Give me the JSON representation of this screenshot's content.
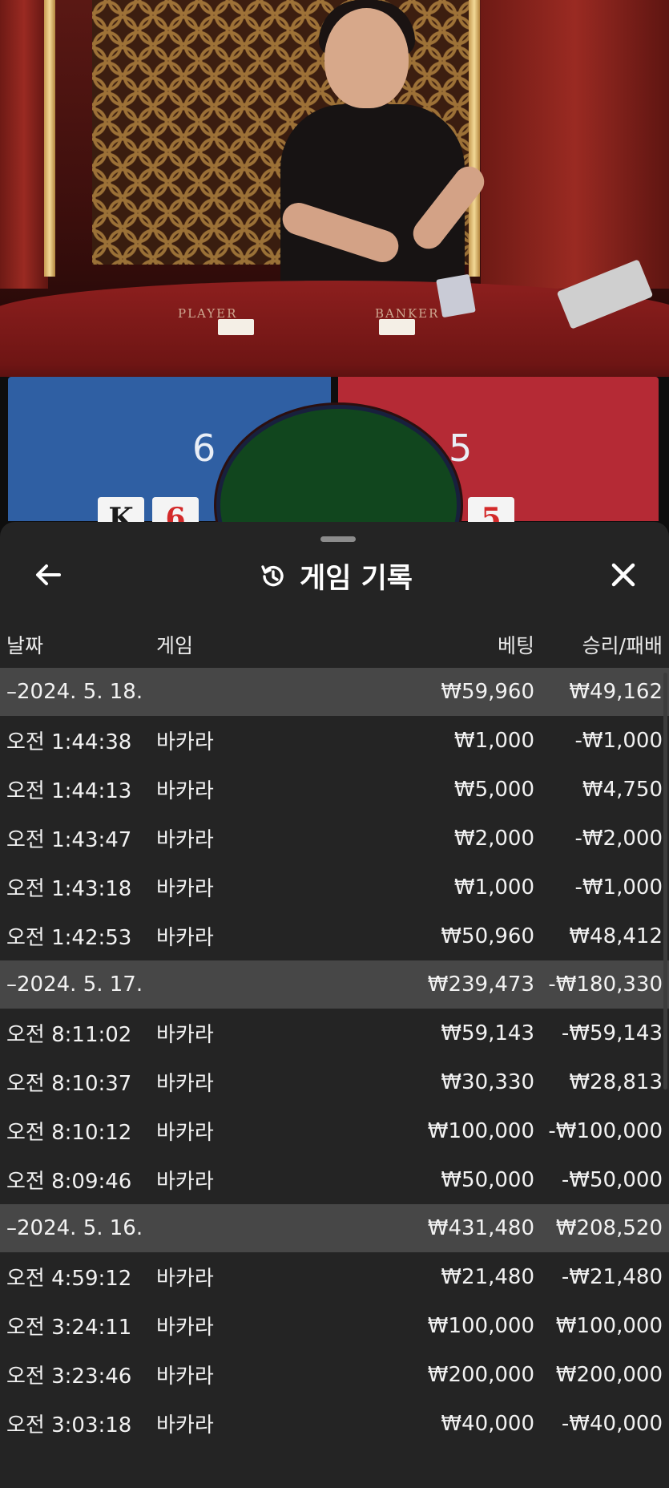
{
  "scene": {
    "felt_left": "PLAYER",
    "felt_right": "BANKER",
    "player_score": "6",
    "banker_score": "5",
    "player_cards": [
      {
        "rank": "K",
        "color": "black"
      },
      {
        "rank": "6",
        "color": "red"
      }
    ],
    "banker_cards": [
      {
        "rank": "5",
        "color": "red"
      }
    ]
  },
  "sheet": {
    "title": "게임 기록",
    "back_icon": "arrow-left",
    "close_icon": "close-x",
    "history_icon": "clock-counterclockwise",
    "columns": {
      "date": "날짜",
      "game": "게임",
      "bet": "베팅",
      "result": "승리/패배"
    },
    "groups": [
      {
        "date": "–2024. 5. 18.",
        "bet_total": "₩59,960",
        "result_total": "₩49,162",
        "rows": [
          {
            "time": "오전 1:44:38",
            "game": "바카라",
            "bet": "₩1,000",
            "result": "-₩1,000"
          },
          {
            "time": "오전 1:44:13",
            "game": "바카라",
            "bet": "₩5,000",
            "result": "₩4,750"
          },
          {
            "time": "오전 1:43:47",
            "game": "바카라",
            "bet": "₩2,000",
            "result": "-₩2,000"
          },
          {
            "time": "오전 1:43:18",
            "game": "바카라",
            "bet": "₩1,000",
            "result": "-₩1,000"
          },
          {
            "time": "오전 1:42:53",
            "game": "바카라",
            "bet": "₩50,960",
            "result": "₩48,412"
          }
        ]
      },
      {
        "date": "–2024. 5. 17.",
        "bet_total": "₩239,473",
        "result_total": "-₩180,330",
        "rows": [
          {
            "time": "오전 8:11:02",
            "game": "바카라",
            "bet": "₩59,143",
            "result": "-₩59,143"
          },
          {
            "time": "오전 8:10:37",
            "game": "바카라",
            "bet": "₩30,330",
            "result": "₩28,813"
          },
          {
            "time": "오전 8:10:12",
            "game": "바카라",
            "bet": "₩100,000",
            "result": "-₩100,000"
          },
          {
            "time": "오전 8:09:46",
            "game": "바카라",
            "bet": "₩50,000",
            "result": "-₩50,000"
          }
        ]
      },
      {
        "date": "–2024. 5. 16.",
        "bet_total": "₩431,480",
        "result_total": "₩208,520",
        "rows": [
          {
            "time": "오전 4:59:12",
            "game": "바카라",
            "bet": "₩21,480",
            "result": "-₩21,480"
          },
          {
            "time": "오전 3:24:11",
            "game": "바카라",
            "bet": "₩100,000",
            "result": "₩100,000"
          },
          {
            "time": "오전 3:23:46",
            "game": "바카라",
            "bet": "₩200,000",
            "result": "₩200,000"
          },
          {
            "time": "오전 3:03:18",
            "game": "바카라",
            "bet": "₩40,000",
            "result": "-₩40,000"
          }
        ]
      }
    ]
  },
  "colors": {
    "player": "#2f5fa3",
    "banker": "#b52a35",
    "sheet_bg": "#242424",
    "date_row_bg": "#474747"
  }
}
